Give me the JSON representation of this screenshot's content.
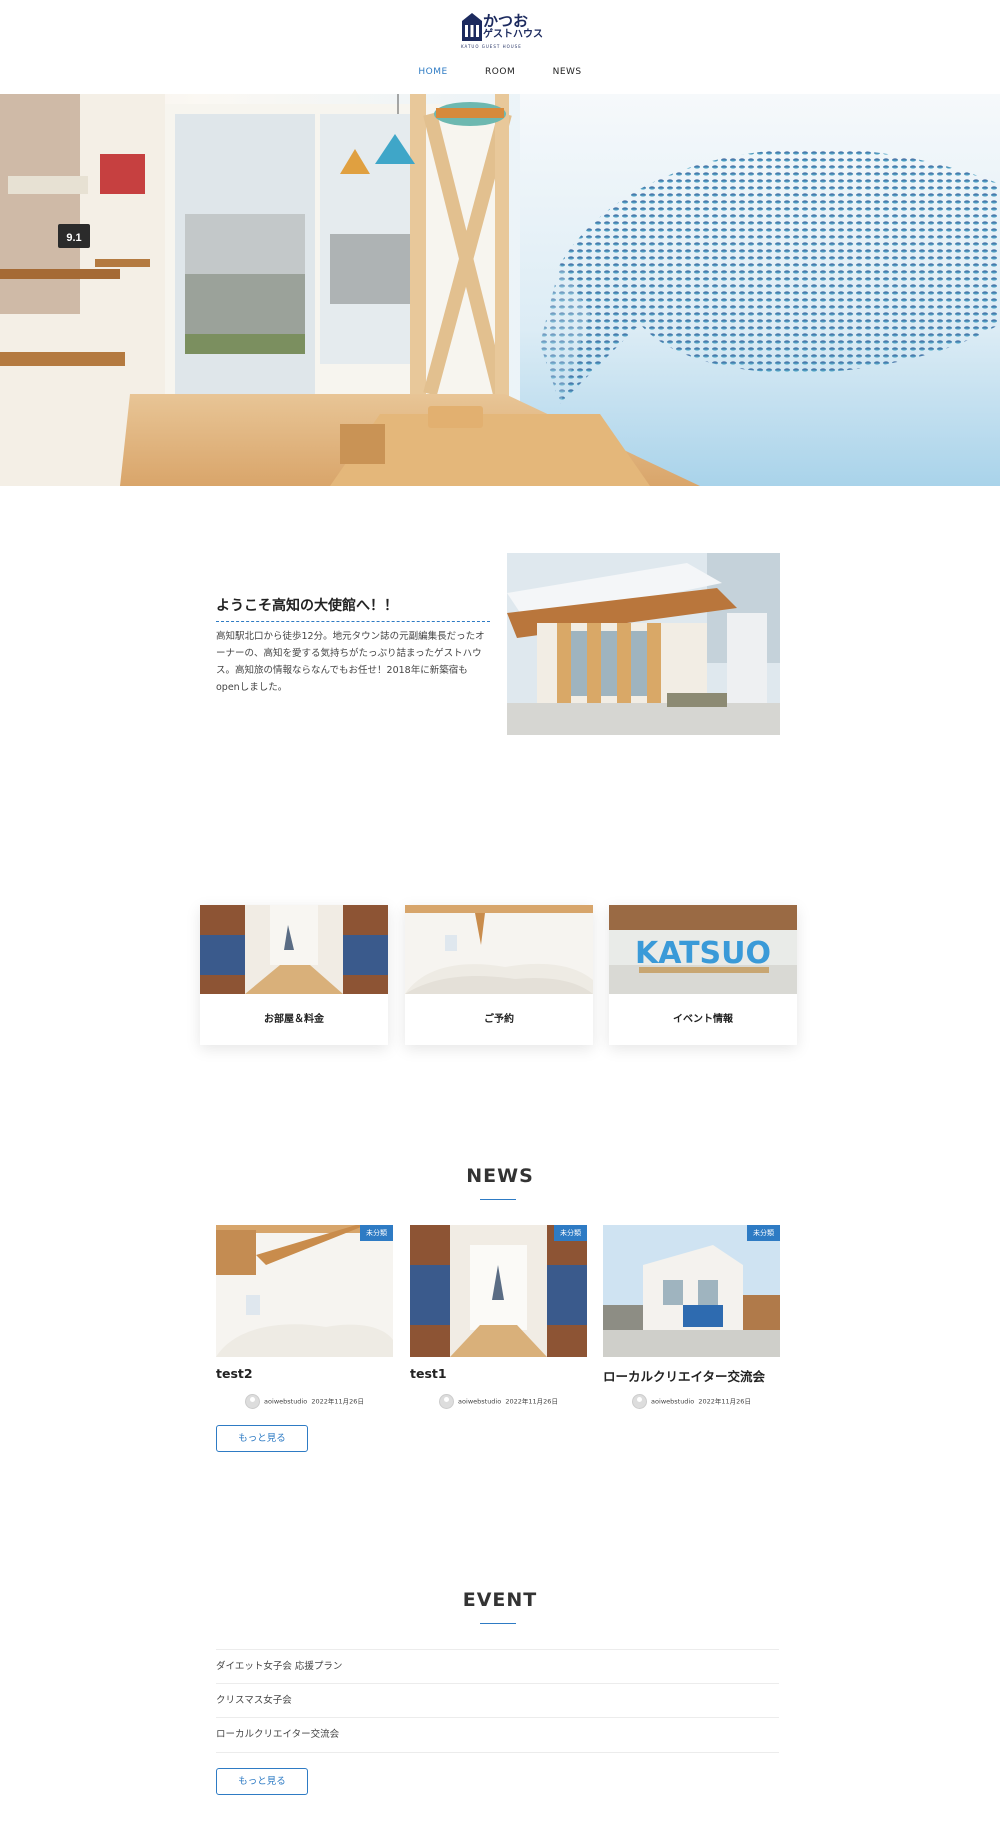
{
  "header": {
    "logo_main": "かつお",
    "logo_sub": "ゲストハウス",
    "logo_tagline": "KATUO GUEST HOUSE",
    "nav": [
      {
        "label": "HOME",
        "active": true
      },
      {
        "label": "ROOM",
        "active": false
      },
      {
        "label": "NEWS",
        "active": false
      }
    ]
  },
  "hero": {
    "board_number": "9.1"
  },
  "welcome": {
    "title": "ようこそ高知の大使館へ！！",
    "body": "高知駅北口から徒歩12分。地元タウン誌の元副編集長だったオーナーの、高知を愛する気持ちがたっぷり詰まったゲストハウス。高知旅の情報ならなんでもお任せ！2018年に新築宿もopenしました。"
  },
  "cards": [
    {
      "label": "お部屋＆料金"
    },
    {
      "label": "ご予約"
    },
    {
      "label": "イベント情報",
      "sign_text": "KATSUO"
    }
  ],
  "news": {
    "title": "NEWS",
    "items": [
      {
        "title": "test2",
        "badge": "未分類",
        "author": "aoiwebstudio",
        "date": "2022年11月26日"
      },
      {
        "title": "test1",
        "badge": "未分類",
        "author": "aoiwebstudio",
        "date": "2022年11月26日"
      },
      {
        "title": "ローカルクリエイター交流会",
        "badge": "未分類",
        "author": "aoiwebstudio",
        "date": "2022年11月26日"
      }
    ],
    "more_label": "もっと見る"
  },
  "event": {
    "title": "EVENT",
    "items": [
      {
        "label": "ダイエット女子会 応援プラン"
      },
      {
        "label": "クリスマス女子会"
      },
      {
        "label": "ローカルクリエイター交流会"
      }
    ],
    "more_label": "もっと見る"
  },
  "colors": {
    "accent": "#2e7bc4",
    "logo_navy": "#1c2a5e"
  }
}
